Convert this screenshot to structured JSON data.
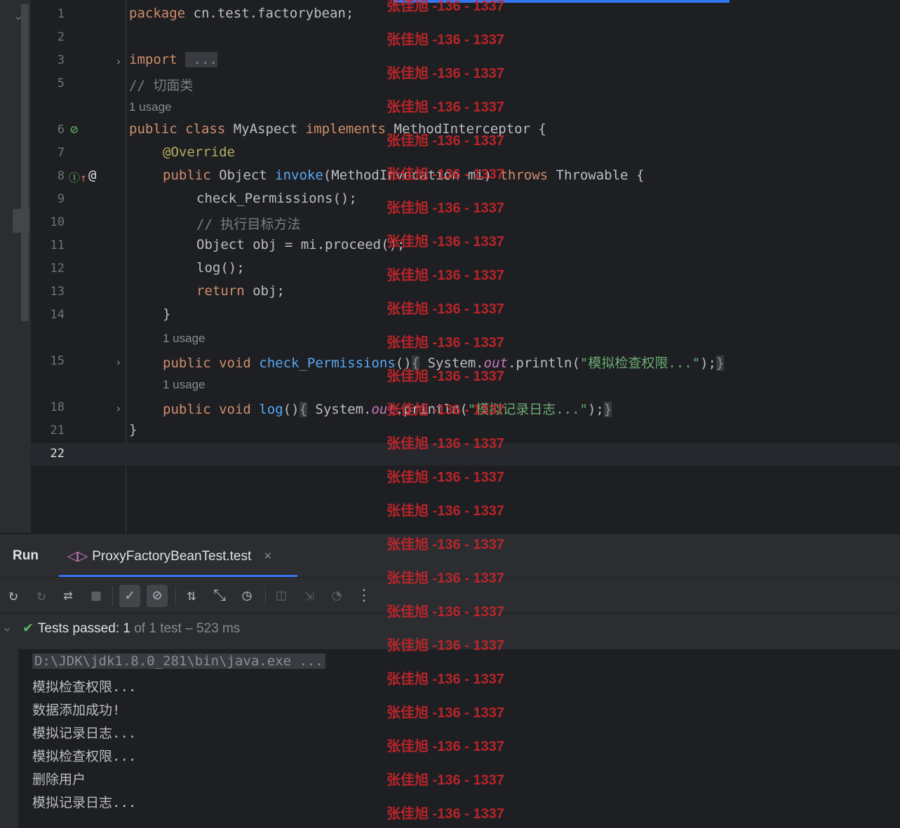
{
  "editor": {
    "line_numbers": [
      "1",
      "2",
      "3",
      "5",
      "6",
      "7",
      "8",
      "9",
      "10",
      "11",
      "12",
      "13",
      "14",
      "15",
      "18",
      "21",
      "22"
    ],
    "usage_label": "1 usage",
    "lines": {
      "l1_kw": "package",
      "l1_rest": " cn.test.factorybean;",
      "l3_kw": "import",
      "l3_fold": " ...",
      "l5": "// 切面类",
      "l6_kw1": "public",
      "l6_kw2": "class",
      "l6_name": " MyAspect ",
      "l6_kw3": "implements",
      "l6_rest": " MethodInterceptor {",
      "l7": "@Override",
      "l8_kw1": "public",
      "l8_type": " Object ",
      "l8_fn": "invoke",
      "l8_params": "(MethodInvocation mi) ",
      "l8_kw2": "throws",
      "l8_rest": " Throwable {",
      "l9": "check_Permissions();",
      "l10": "// 执行目标方法",
      "l11": "Object obj = mi.proceed();",
      "l12": "log();",
      "l13_kw": "return",
      "l13_rest": " obj;",
      "l14": "}",
      "l15_kw": "public void",
      "l15_fn": "check_Permissions",
      "l15_p": "()",
      "l15_body_a": " System.",
      "l15_out": "out",
      "l15_body_b": ".println(",
      "l15_str": "\"模拟检查权限...\"",
      "l15_end": ");",
      "l18_kw": "public void",
      "l18_fn": "log",
      "l18_p": "()",
      "l18_body_a": " System.",
      "l18_out": "out",
      "l18_body_b": ".println(",
      "l18_str": "\"模拟记录日志...\"",
      "l18_end": ");",
      "l21": "}"
    }
  },
  "run": {
    "label": "Run",
    "tab": "ProxyFactoryBeanTest.test",
    "close": "×",
    "status_passed": "Tests passed:",
    "status_count": "1",
    "status_of": "of 1 test",
    "status_time": "– 523 ms"
  },
  "console": {
    "cmd": "D:\\JDK\\jdk1.8.0_281\\bin\\java.exe ...",
    "lines": [
      "模拟检查权限...",
      "数据添加成功!",
      "模拟记录日志...",
      "模拟检查权限...",
      "删除用户",
      "模拟记录日志..."
    ]
  },
  "watermark": "张佳旭 -136 - 1337",
  "icons": {
    "fold": "chevron-down-icon",
    "expand": "chevron-right-icon",
    "no_impl": "not-allowed-icon",
    "override": "override-icon",
    "annotation": "at-icon",
    "rerun": "rerun-icon",
    "rerun_failed": "rerun-failed-icon",
    "toggle_auto": "toggle-auto-test-icon",
    "stop": "stop-icon",
    "show_passed": "check-icon",
    "show_ignored": "ignored-icon",
    "sort": "sort-icon",
    "collapse": "collapse-icon",
    "history": "history-icon",
    "screenshot": "camera-icon",
    "import": "import-icon",
    "coverage": "gauge-icon",
    "more": "more-vertical-icon",
    "passed": "check-icon"
  }
}
